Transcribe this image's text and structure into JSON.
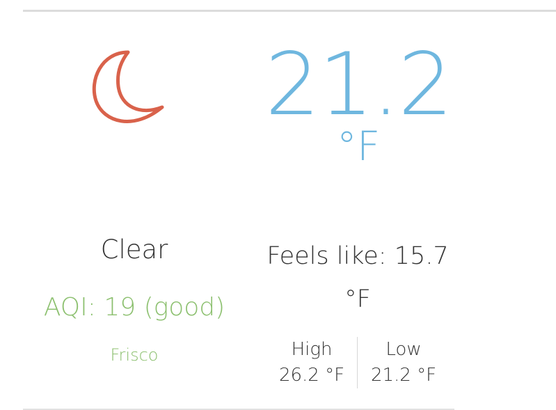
{
  "weather": {
    "condition": "Clear",
    "condition_icon": "moon-icon",
    "temperature": "21.2",
    "temperature_unit": "°F",
    "feels_like": "Feels like: 15.7 °F",
    "aqi": "AQI: 19 (good)",
    "location": "Frisco",
    "high_label": "High",
    "high_value": "26.2 °F",
    "low_label": "Low",
    "low_value": "21.2 °F"
  },
  "colors": {
    "temperature": "#6fb7df",
    "icon": "#d9624b",
    "aqi_good": "#8cc06f",
    "text": "#333333"
  }
}
